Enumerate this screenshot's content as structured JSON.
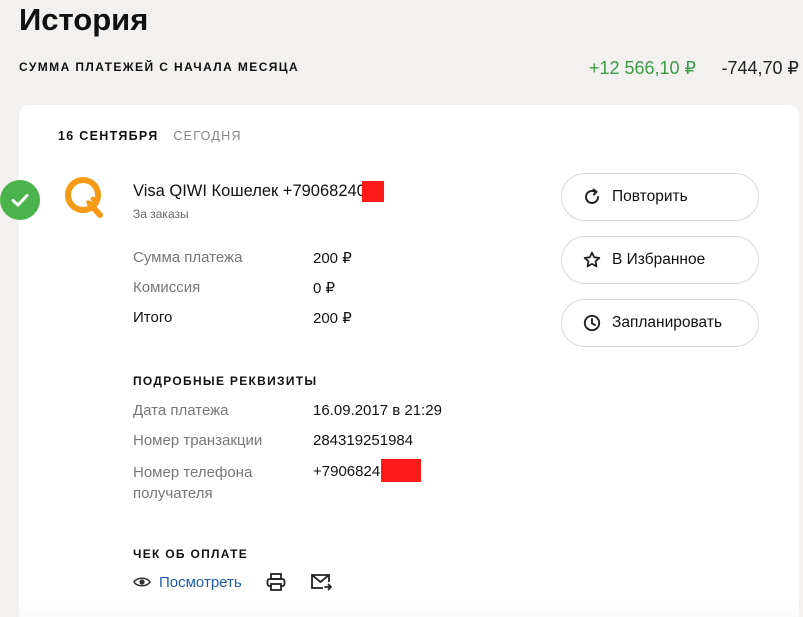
{
  "page": {
    "title": "История"
  },
  "summary": {
    "label": "СУММА ПЛАТЕЖЕЙ С НАЧАЛА МЕСЯЦА",
    "income": "+12 566,10 ₽",
    "expense": "-744,70 ₽",
    "income_color": "#3d9a48"
  },
  "history": {
    "date": "16 СЕНТЯБРЯ",
    "today": "СЕГОДНЯ"
  },
  "payment": {
    "title": "Visa QIWI Кошелек +79068240",
    "subtitle": "За заказы",
    "status_icon": "check-icon",
    "provider_icon": "qiwi-logo",
    "amount_label": "Сумма платежа",
    "amount_value": "200 ₽",
    "commission_label": "Комиссия",
    "commission_value": "0 ₽",
    "total_label": "Итого",
    "total_value": "200 ₽"
  },
  "details": {
    "heading": "ПОДРОБНЫЕ РЕКВИЗИТЫ",
    "date_label": "Дата платежа",
    "date_value": "16.09.2017 в 21:29",
    "txn_label": "Номер транзакции",
    "txn_value": "284319251984",
    "phone_label_line1": "Номер телефона",
    "phone_label_line2": "получателя",
    "phone_value": "+7906824"
  },
  "receipt": {
    "heading": "ЧЕК ОБ ОПЛАТЕ",
    "view_label": "Посмотреть",
    "link_color": "#1f5ea8"
  },
  "actions": {
    "repeat_label": "Повторить",
    "favorite_label": "В Избранное",
    "schedule_label": "Запланировать"
  }
}
